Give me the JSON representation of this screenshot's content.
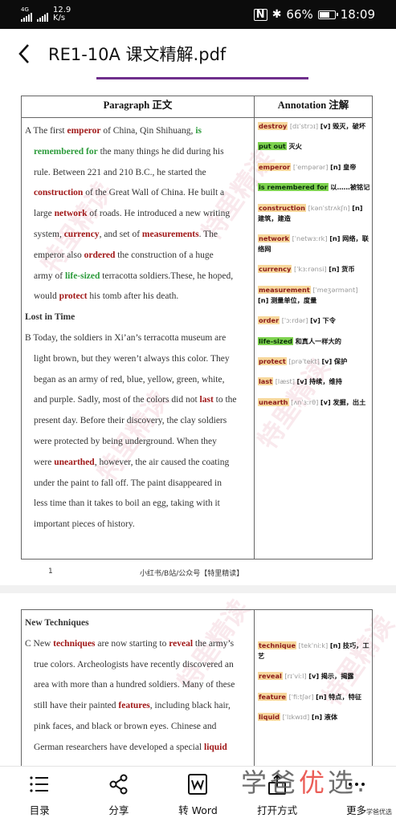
{
  "status_bar": {
    "network_type": "4G",
    "net_speed_value": "12.9",
    "net_speed_unit": "K/s",
    "battery": "66%",
    "battery_level": 0.66,
    "time": "18:09"
  },
  "header": {
    "title": "RE1-10A 课文精解.pdf",
    "back_icon": "chevron-left-icon"
  },
  "page1": {
    "col_para_header": "Paragraph 正文",
    "col_ann_header": "Annotation 注解",
    "para_a": {
      "l1_pre": "A The first ",
      "l1_emperor": "emperor",
      "l1_mid": " of China, Qin Shihuang, ",
      "l1_is": "is",
      "l2_rem": "remembered for",
      "l2_post": " the many things he did during his",
      "l3": "rule. Between 221 and 210 B.C., he started the",
      "l4_construction": "construction",
      "l4_post": " of the Great Wall of China. He built a",
      "l5_pre": "large ",
      "l5_network": "network",
      "l5_post": " of roads. He introduced a new writing",
      "l6_pre": "system, ",
      "l6_currency": "currency",
      "l6_mid": ", and set of ",
      "l6_measurements": "measurements",
      "l6_post": ". The",
      "l7_pre": "emperor also ",
      "l7_ordered": "ordered",
      "l7_post": " the construction of a huge",
      "l8_pre": "army of ",
      "l8_life": "life-sized",
      "l8_post": " terracotta soldiers.These, he hoped,",
      "l9_pre": "would ",
      "l9_protect": "protect",
      "l9_post": " his tomb after his death."
    },
    "subheading": "Lost in Time",
    "para_b": {
      "l1": "B Today, the soldiers in Xi’an’s terracotta museum are",
      "l2": "light brown, but they weren’t always this color. They",
      "l3": "began as an army of red, blue, yellow, green, white,",
      "l4_pre": "and purple. Sadly, most of the colors did not ",
      "l4_last": "last",
      "l4_post": " to the",
      "l5": "present day. Before their discovery, the clay soldiers",
      "l6": "were protected by being underground. When they",
      "l7_pre": "were ",
      "l7_unearthed": "unearthed",
      "l7_post": ", however, the air caused the coating",
      "l8": "under the paint to fall off. The paint disappeared in",
      "l9": "less time than it takes to boil an egg, taking with it",
      "l10": "important pieces of history."
    },
    "annotations": [
      {
        "word": "destroy",
        "phon": "[dɪˈstrɔɪ]",
        "pos": "[v]",
        "meaning": "毁灭，破坏",
        "style": "o"
      },
      {
        "word": "put out",
        "phon": "",
        "pos": "",
        "meaning": "灭火",
        "style": "g"
      },
      {
        "word": "emperor",
        "phon": "[ˈempərər]",
        "pos": "[n]",
        "meaning": "皇帝",
        "style": "o"
      },
      {
        "word": "is remembered for",
        "phon": "",
        "pos": "",
        "meaning": "以……被铭记",
        "style": "g"
      },
      {
        "word": "construction",
        "phon": "[kənˈstrʌkʃn]",
        "pos": "[n]",
        "meaning": "建筑，建造",
        "style": "o"
      },
      {
        "word": "network",
        "phon": "[ˈnetwɜːrk]",
        "pos": "[n]",
        "meaning": "网络，联络网",
        "style": "o"
      },
      {
        "word": "currency",
        "phon": "[ˈkɜːrənsi]",
        "pos": "[n]",
        "meaning": "货币",
        "style": "o"
      },
      {
        "word": "measurement",
        "phon": "[ˈmeʒərmənt]",
        "pos": "[n]",
        "meaning": "测量单位，度量",
        "style": "o"
      },
      {
        "word": "order",
        "phon": "[ˈɔːrdər]",
        "pos": "[v]",
        "meaning": "下令",
        "style": "o"
      },
      {
        "word": "life-sized",
        "phon": "",
        "pos": "",
        "meaning": "和真人一样大的",
        "style": "g"
      },
      {
        "word": "protect",
        "phon": "[prəˈtekt]",
        "pos": "[v]",
        "meaning": "保护",
        "style": "o"
      },
      {
        "word": "last",
        "phon": "[læst]",
        "pos": "[v]",
        "meaning": "持续，维持",
        "style": "o"
      },
      {
        "word": "unearth",
        "phon": "[ʌnˈɜːrθ]",
        "pos": "[v]",
        "meaning": "发掘，出土",
        "style": "o"
      }
    ],
    "page_number": "1",
    "source_note": "小红书/B站/公众号【特里精读】"
  },
  "page2": {
    "subheading": "New Techniques",
    "para_c": {
      "l1_pre": "C New ",
      "l1_techniques": "techniques",
      "l1_mid": " are now starting to ",
      "l1_reveal": "reveal",
      "l1_post": " the army’s",
      "l2": "true colors. Archeologists have recently discovered an",
      "l3": "area with more than a hundred soldiers. Many of these",
      "l4_pre": "still have their painted ",
      "l4_features": "features",
      "l4_post": ", including black hair,",
      "l5": "pink faces, and black or brown eyes. Chinese and",
      "l6_pre": "German researchers have developed a special ",
      "l6_liquid": "liquid"
    },
    "annotations": [
      {
        "word": "technique",
        "phon": "[tekˈniːk]",
        "pos": "[n]",
        "meaning": "技巧，工艺",
        "style": "o"
      },
      {
        "word": "reveal",
        "phon": "[rɪˈviːl]",
        "pos": "[v]",
        "meaning": "揭示，揭露",
        "style": "o"
      },
      {
        "word": "feature",
        "phon": "[ˈfiːtʃər]",
        "pos": "[n]",
        "meaning": "特点，特征",
        "style": "o"
      },
      {
        "word": "liquid",
        "phon": "[ˈlɪkwɪd]",
        "pos": "[n]",
        "meaning": "液体",
        "style": "o"
      }
    ]
  },
  "watermark_text": "特里精读",
  "toolbar": {
    "toc": "目录",
    "share": "分享",
    "to_word": "转 Word",
    "open_with": "打开方式",
    "more": "更多"
  },
  "brand": {
    "part1": "学爸",
    "part2": "优",
    "part3": "选.",
    "small": "学爸优选"
  }
}
